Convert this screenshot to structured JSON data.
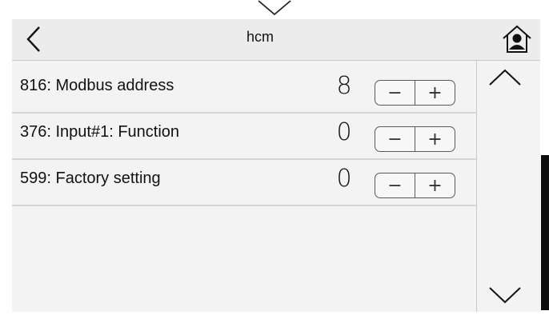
{
  "header": {
    "title": "hcm"
  },
  "icons": {
    "top": "chevron-down-icon",
    "back": "chevron-left-icon",
    "home": "home-user-icon",
    "scroll_up": "chevron-up-icon",
    "scroll_down": "chevron-down-icon"
  },
  "parameters": [
    {
      "label": "816: Modbus address",
      "value": "8",
      "minus": "−",
      "plus": "+"
    },
    {
      "label": "376: Input#1: Function",
      "value": "0",
      "minus": "−",
      "plus": "+"
    },
    {
      "label": "599: Factory setting",
      "value": "0",
      "minus": "−",
      "plus": "+"
    }
  ],
  "colors": {
    "panel_bg": "#f3f3f3",
    "header_bg": "#ececec",
    "divider": "#d4d4d4",
    "text": "#111111"
  }
}
